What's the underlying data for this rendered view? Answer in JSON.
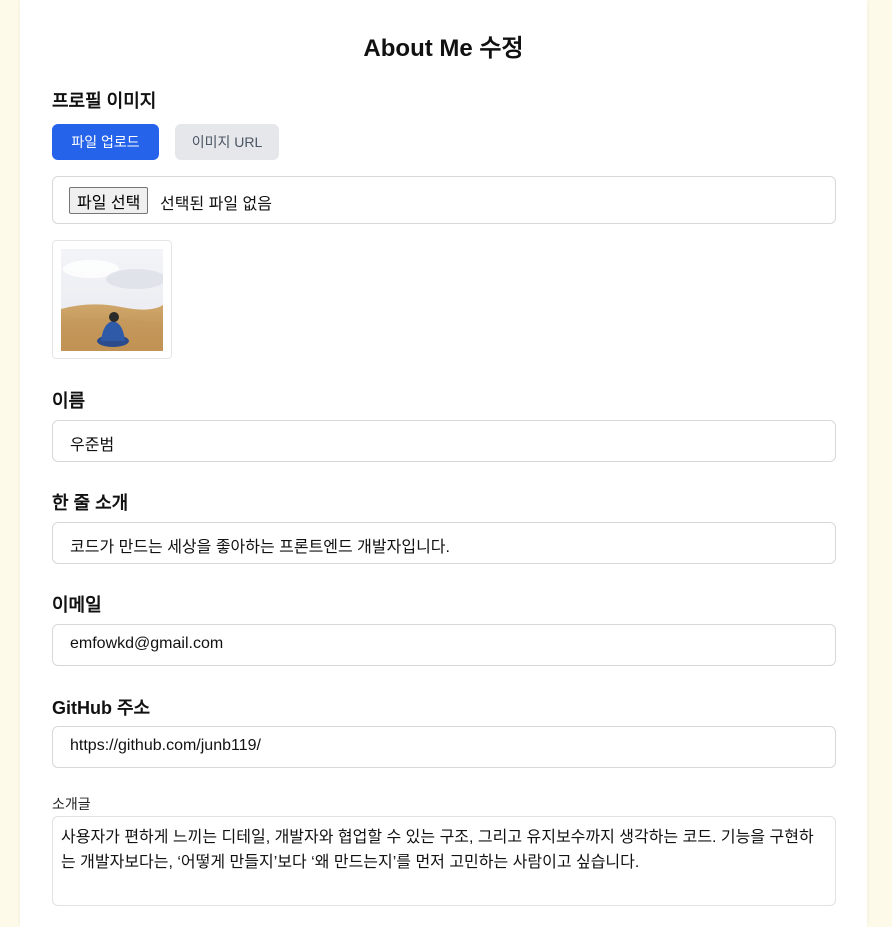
{
  "page": {
    "title": "About Me 수정"
  },
  "profile_image": {
    "label": "프로필 이미지",
    "tabs": {
      "upload": "파일 업로드",
      "url": "이미지 URL"
    },
    "file_button": "파일 선택",
    "file_status": "선택된 파일 없음"
  },
  "fields": {
    "name": {
      "label": "이름",
      "value": "우준범"
    },
    "tagline": {
      "label": "한 줄 소개",
      "value": "코드가 만드는 세상을 좋아하는 프론트엔드 개발자입니다."
    },
    "email": {
      "label": "이메일",
      "value": "emfowkd@gmail.com"
    },
    "github": {
      "label": "GitHub 주소",
      "value": "https://github.com/junb119/"
    },
    "intro": {
      "label": "소개글",
      "value": "사용자가 편하게 느끼는 디테일, 개발자와 협업할 수 있는 구조, 그리고 유지보수까지 생각하는 코드. 기능을 구현하는 개발자보다는, ‘어떻게 만들지’보다 ‘왜 만드는지’를 먼저 고민하는 사람이고 싶습니다."
    }
  },
  "colors": {
    "background": "#fefaea",
    "primary": "#2563eb",
    "secondary_button": "#e5e7eb"
  }
}
